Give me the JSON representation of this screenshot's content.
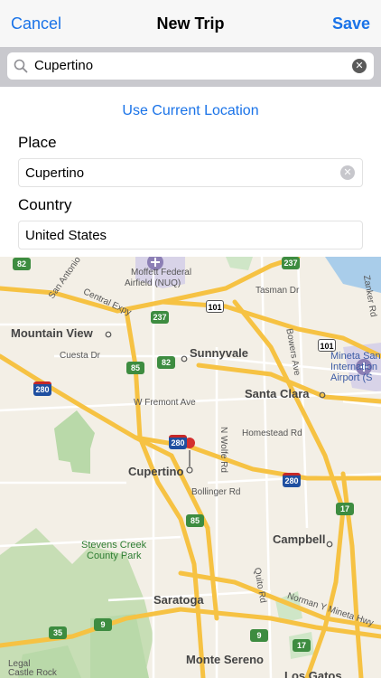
{
  "navbar": {
    "cancel_label": "Cancel",
    "title": "New Trip",
    "save_label": "Save"
  },
  "search": {
    "value": "Cupertino"
  },
  "form": {
    "use_current_location": "Use Current Location",
    "place_label": "Place",
    "place_value": "Cupertino",
    "country_label": "Country",
    "country_value": "United States"
  },
  "map": {
    "labels": {
      "moffett": "Moffett Federal",
      "moffett2": "Airfield (NUQ)",
      "tasman": "Tasman Dr",
      "zanker": "Zanker Rd",
      "san_antonio": "San Antonio",
      "central_expy": "Central Expy",
      "mountain_view": "Mountain View",
      "cuesta": "Cuesta Dr",
      "sunnyvale": "Sunnyvale",
      "bowers": "Bowers Ave",
      "santa_clara": "Santa Clara",
      "mineta": "Mineta San",
      "mineta2": "Internation",
      "mineta3": "Airport (S",
      "fremont": "W Fremont Ave",
      "homestead": "Homestead Rd",
      "wolfe": "N Wolfe Rd",
      "cupertino": "Cupertino",
      "bollinger": "Bollinger Rd",
      "campbell": "Campbell",
      "stevens_creek": "Stevens Creek",
      "county_park": "County Park",
      "quito": "Quito Rd",
      "saratoga": "Saratoga",
      "norman_mineta": "Norman Y Mineta Hwy",
      "monte_sereno": "Monte Sereno",
      "los_gatos": "Los Gatos",
      "legal": "Legal",
      "castle_rock": "Castle Rock"
    },
    "shields": {
      "s82a": "82",
      "s237a": "237",
      "s237b": "237",
      "s101a": "101",
      "s101b": "101",
      "s85a": "85",
      "s82b": "82",
      "s280a": "280",
      "s280b": "280",
      "s280c": "280",
      "s17a": "17",
      "s85b": "85",
      "s9": "9",
      "s35": "35",
      "s9b": "9",
      "s17b": "17"
    }
  }
}
